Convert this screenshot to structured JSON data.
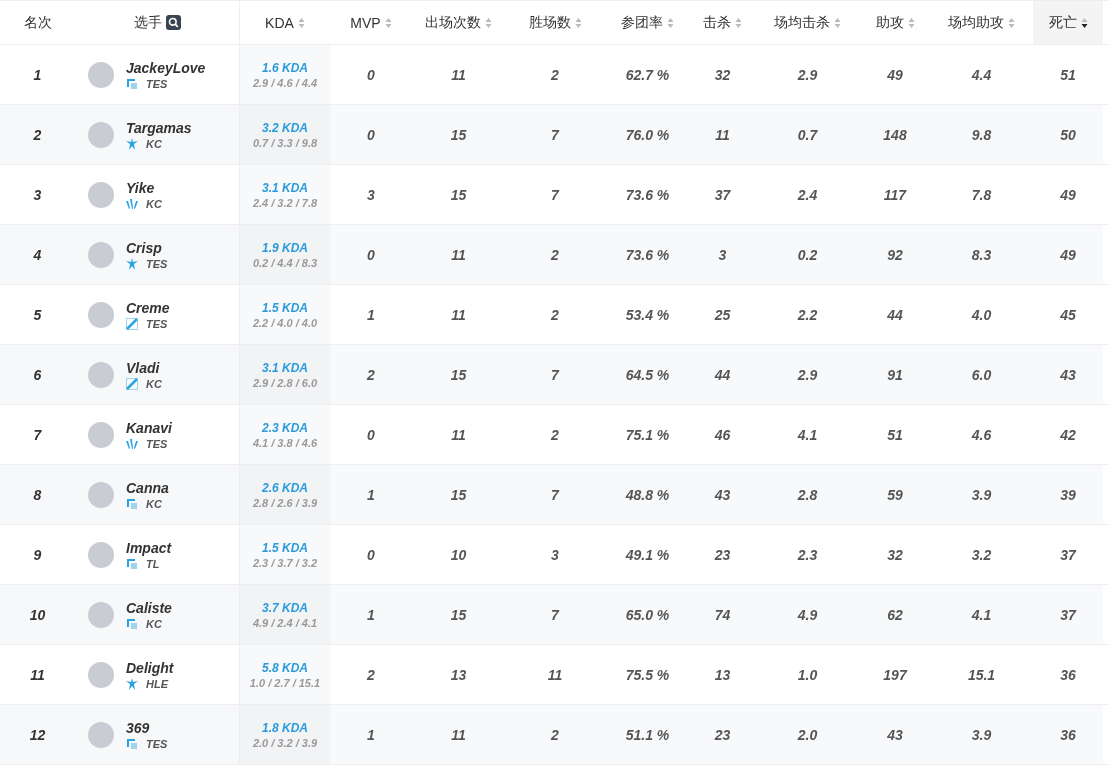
{
  "columns": [
    {
      "label": "名次",
      "kind": "plain"
    },
    {
      "label": "选手",
      "kind": "search"
    },
    {
      "label": "KDA",
      "kind": "sortable",
      "sorted": false
    },
    {
      "label": "MVP",
      "kind": "sortable",
      "sorted": false
    },
    {
      "label": "出场次数",
      "kind": "sortable",
      "sorted": false
    },
    {
      "label": "胜场数",
      "kind": "sortable",
      "sorted": false
    },
    {
      "label": "参团率",
      "kind": "sortable",
      "sorted": false
    },
    {
      "label": "击杀",
      "kind": "sortable",
      "sorted": false
    },
    {
      "label": "场均击杀",
      "kind": "sortable",
      "sorted": false
    },
    {
      "label": "助攻",
      "kind": "sortable",
      "sorted": false
    },
    {
      "label": "场均助攻",
      "kind": "sortable",
      "sorted": false
    },
    {
      "label": "死亡",
      "kind": "sortable",
      "sorted": true
    }
  ],
  "rows": [
    {
      "rank": "1",
      "name": "JackeyLove",
      "team": "TES",
      "emblem": {
        "kind": "square"
      },
      "kda": "1.6 KDA",
      "kda_detail": "2.9 / 4.6 / 4.4",
      "stats": [
        "0",
        "11",
        "2",
        "62.7 %",
        "32",
        "2.9",
        "49",
        "4.4",
        "51"
      ]
    },
    {
      "rank": "2",
      "name": "Targamas",
      "team": "KC",
      "emblem": {
        "kind": "star"
      },
      "kda": "3.2 KDA",
      "kda_detail": "0.7 / 3.3 / 9.8",
      "stats": [
        "0",
        "15",
        "7",
        "76.0 %",
        "11",
        "0.7",
        "148",
        "9.8",
        "50"
      ]
    },
    {
      "rank": "3",
      "name": "Yike",
      "team": "KC",
      "emblem": {
        "kind": "claw"
      },
      "kda": "3.1 KDA",
      "kda_detail": "2.4 / 3.2 / 7.8",
      "stats": [
        "3",
        "15",
        "7",
        "73.6 %",
        "37",
        "2.4",
        "117",
        "7.8",
        "49"
      ]
    },
    {
      "rank": "4",
      "name": "Crisp",
      "team": "TES",
      "emblem": {
        "kind": "star"
      },
      "kda": "1.9 KDA",
      "kda_detail": "0.2 / 4.4 / 8.3",
      "stats": [
        "0",
        "11",
        "2",
        "73.6 %",
        "3",
        "0.2",
        "92",
        "8.3",
        "49"
      ]
    },
    {
      "rank": "5",
      "name": "Creme",
      "team": "TES",
      "emblem": {
        "kind": "slash"
      },
      "kda": "1.5 KDA",
      "kda_detail": "2.2 / 4.0 / 4.0",
      "stats": [
        "1",
        "11",
        "2",
        "53.4 %",
        "25",
        "2.2",
        "44",
        "4.0",
        "45"
      ]
    },
    {
      "rank": "6",
      "name": "Vladi",
      "team": "KC",
      "emblem": {
        "kind": "slash"
      },
      "kda": "3.1 KDA",
      "kda_detail": "2.9 / 2.8 / 6.0",
      "stats": [
        "2",
        "15",
        "7",
        "64.5 %",
        "44",
        "2.9",
        "91",
        "6.0",
        "43"
      ]
    },
    {
      "rank": "7",
      "name": "Kanavi",
      "team": "TES",
      "emblem": {
        "kind": "claw"
      },
      "kda": "2.3 KDA",
      "kda_detail": "4.1 / 3.8 / 4.6",
      "stats": [
        "0",
        "11",
        "2",
        "75.1 %",
        "46",
        "4.1",
        "51",
        "4.6",
        "42"
      ]
    },
    {
      "rank": "8",
      "name": "Canna",
      "team": "KC",
      "emblem": {
        "kind": "square"
      },
      "kda": "2.6 KDA",
      "kda_detail": "2.8 / 2.6 / 3.9",
      "stats": [
        "1",
        "15",
        "7",
        "48.8 %",
        "43",
        "2.8",
        "59",
        "3.9",
        "39"
      ]
    },
    {
      "rank": "9",
      "name": "Impact",
      "team": "TL",
      "emblem": {
        "kind": "square"
      },
      "kda": "1.5 KDA",
      "kda_detail": "2.3 / 3.7 / 3.2",
      "stats": [
        "0",
        "10",
        "3",
        "49.1 %",
        "23",
        "2.3",
        "32",
        "3.2",
        "37"
      ]
    },
    {
      "rank": "10",
      "name": "Caliste",
      "team": "KC",
      "emblem": {
        "kind": "square"
      },
      "kda": "3.7 KDA",
      "kda_detail": "4.9 / 2.4 / 4.1",
      "stats": [
        "1",
        "15",
        "7",
        "65.0 %",
        "74",
        "4.9",
        "62",
        "4.1",
        "37"
      ]
    },
    {
      "rank": "11",
      "name": "Delight",
      "team": "HLE",
      "emblem": {
        "kind": "star"
      },
      "kda": "5.8 KDA",
      "kda_detail": "1.0 / 2.7 / 15.1",
      "stats": [
        "2",
        "13",
        "11",
        "75.5 %",
        "13",
        "1.0",
        "197",
        "15.1",
        "36"
      ]
    },
    {
      "rank": "12",
      "name": "369",
      "team": "TES",
      "emblem": {
        "kind": "square"
      },
      "kda": "1.8 KDA",
      "kda_detail": "2.0 / 3.2 / 3.9",
      "stats": [
        "1",
        "11",
        "2",
        "51.1 %",
        "23",
        "2.0",
        "43",
        "3.9",
        "36"
      ]
    }
  ]
}
